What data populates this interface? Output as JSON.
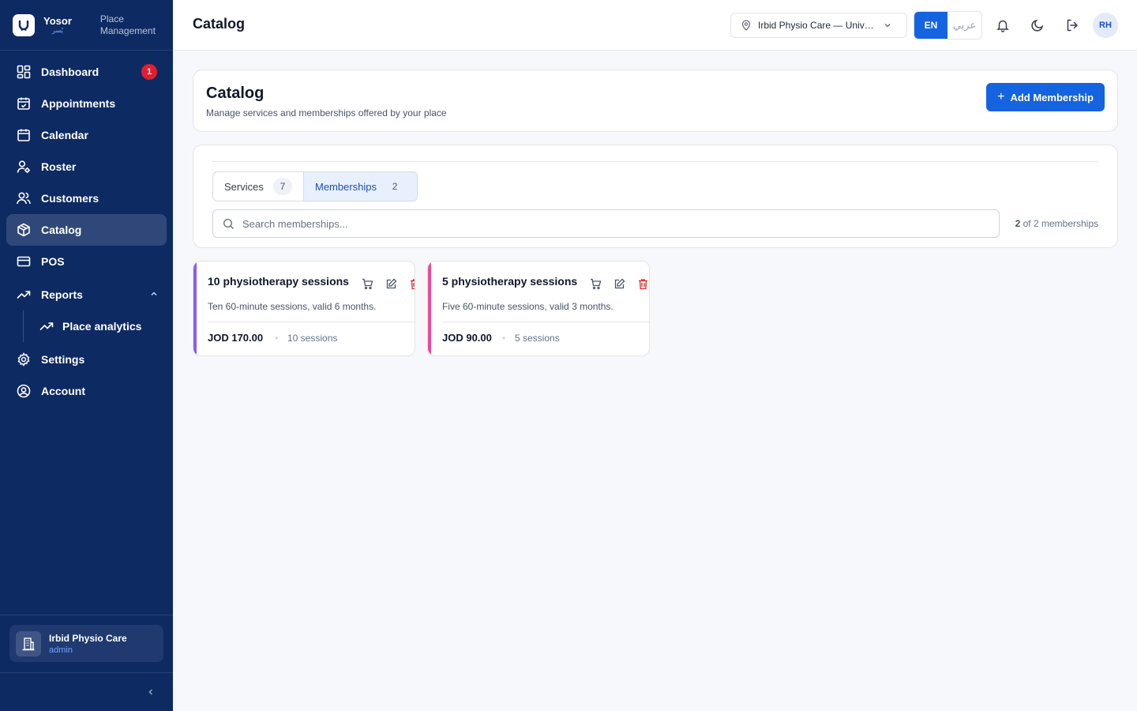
{
  "brand": {
    "name": "Yosor",
    "name_ar": "يُسر",
    "subtitle_line1": "Place",
    "subtitle_line2": "Management"
  },
  "sidebar": {
    "items": [
      {
        "label": "Dashboard",
        "icon": "dashboard-icon",
        "badge": "1"
      },
      {
        "label": "Appointments",
        "icon": "calendar-check-icon"
      },
      {
        "label": "Calendar",
        "icon": "calendar-icon"
      },
      {
        "label": "Roster",
        "icon": "user-cog-icon"
      },
      {
        "label": "Customers",
        "icon": "users-icon"
      },
      {
        "label": "Catalog",
        "icon": "package-icon",
        "active": true
      },
      {
        "label": "POS",
        "icon": "credit-card-icon"
      },
      {
        "label": "Reports",
        "icon": "trending-up-icon",
        "expanded": true
      },
      {
        "label": "Place analytics",
        "icon": "trending-up-icon"
      },
      {
        "label": "Settings",
        "icon": "gear-icon"
      },
      {
        "label": "Account",
        "icon": "user-circle-icon"
      }
    ],
    "place": {
      "name": "Irbid Physio Care",
      "role": "admin"
    }
  },
  "header": {
    "title": "Catalog",
    "place_select": "Irbid Physio Care — University Branch",
    "lang_en": "EN",
    "lang_ar": "عربي",
    "avatar": "RH"
  },
  "page": {
    "title": "Catalog",
    "subtitle": "Manage services and memberships offered by your place",
    "add_button": "Add Membership"
  },
  "tabs": [
    {
      "label": "Services",
      "count": "7"
    },
    {
      "label": "Memberships",
      "count": "2",
      "active": true
    }
  ],
  "search": {
    "placeholder": "Search memberships..."
  },
  "result_count": {
    "shown": "2",
    "text": "of 2 memberships"
  },
  "memberships": [
    {
      "title": "10 physiotherapy sessions",
      "description": "Ten 60-minute sessions, valid 6 months.",
      "price": "JOD 170.00",
      "sessions": "10 sessions",
      "color": "#8b5cf6"
    },
    {
      "title": "5 physiotherapy sessions",
      "description": "Five 60-minute sessions, valid 3 months.",
      "price": "JOD 90.00",
      "sessions": "5 sessions",
      "color": "#ec4899"
    }
  ],
  "colors": {
    "sidebar": "#0e2a63",
    "accent": "#1463e0",
    "danger": "#e11d2e"
  }
}
